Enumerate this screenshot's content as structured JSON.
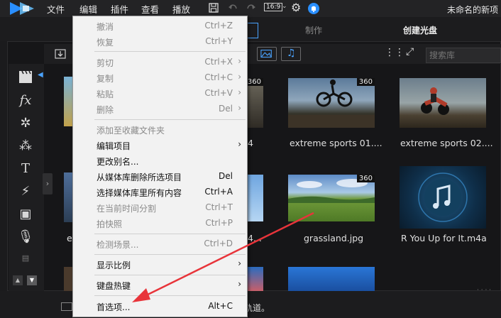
{
  "menubar": {
    "items": [
      "文件",
      "编辑",
      "插件",
      "查看",
      "播放"
    ],
    "aspect_ratio": "16:9",
    "project_title": "未命名的新项"
  },
  "tabs": {
    "produce": "制作",
    "create_disc": "创建光盘"
  },
  "library": {
    "search_placeholder": "搜索库",
    "items": [
      {
        "caption": "extreme sports 01....",
        "badge": "360"
      },
      {
        "caption": "extreme sports 02...."
      },
      {
        "caption": "grassland.jpg",
        "badge": "360"
      },
      {
        "caption": "R You Up for It.m4a"
      }
    ],
    "partial_labels": {
      "badge": "360",
      "caption_a": "4",
      "caption_b": "4...",
      "caption_c": "e"
    }
  },
  "bottom": {
    "text": "轨道。"
  },
  "context_menu": {
    "items": [
      {
        "label": "撤消",
        "key": "Ctrl+Z",
        "disabled": true
      },
      {
        "label": "恢复",
        "key": "Ctrl+Y",
        "disabled": true
      },
      {
        "label": "剪切",
        "key": "Ctrl+X",
        "disabled": true,
        "submenu": true
      },
      {
        "label": "复制",
        "key": "Ctrl+C",
        "disabled": true,
        "submenu": true
      },
      {
        "label": "粘贴",
        "key": "Ctrl+V",
        "disabled": true,
        "submenu": true
      },
      {
        "label": "删除",
        "key": "Del",
        "disabled": true,
        "submenu": true
      },
      {
        "label": "添加至收藏文件夹",
        "key": "",
        "disabled": true
      },
      {
        "label": "编辑项目",
        "key": "",
        "disabled": false,
        "submenu": true
      },
      {
        "label": "更改别名...",
        "key": "",
        "disabled": false
      },
      {
        "label": "从媒体库删除所选项目",
        "key": "Del",
        "disabled": false
      },
      {
        "label": "选择媒体库里所有内容",
        "key": "Ctrl+A",
        "disabled": false
      },
      {
        "label": "在当前时间分割",
        "key": "Ctrl+T",
        "disabled": true
      },
      {
        "label": "拍快照",
        "key": "Ctrl+P",
        "disabled": true
      },
      {
        "label": "检测场景...",
        "key": "Ctrl+D",
        "disabled": true
      },
      {
        "label": "显示比例",
        "key": "",
        "disabled": false,
        "submenu": true
      },
      {
        "label": "键盘热键",
        "key": "",
        "disabled": false,
        "submenu": true
      },
      {
        "label": "首选项...",
        "key": "Alt+C",
        "disabled": false
      }
    ],
    "submenu_glyph": "›"
  },
  "colors": {
    "accent": "#4aa3ff",
    "annotation_arrow": "#e8343a",
    "menu_bg": "#f2f2f2",
    "app_bg": "#1b1b1d"
  }
}
